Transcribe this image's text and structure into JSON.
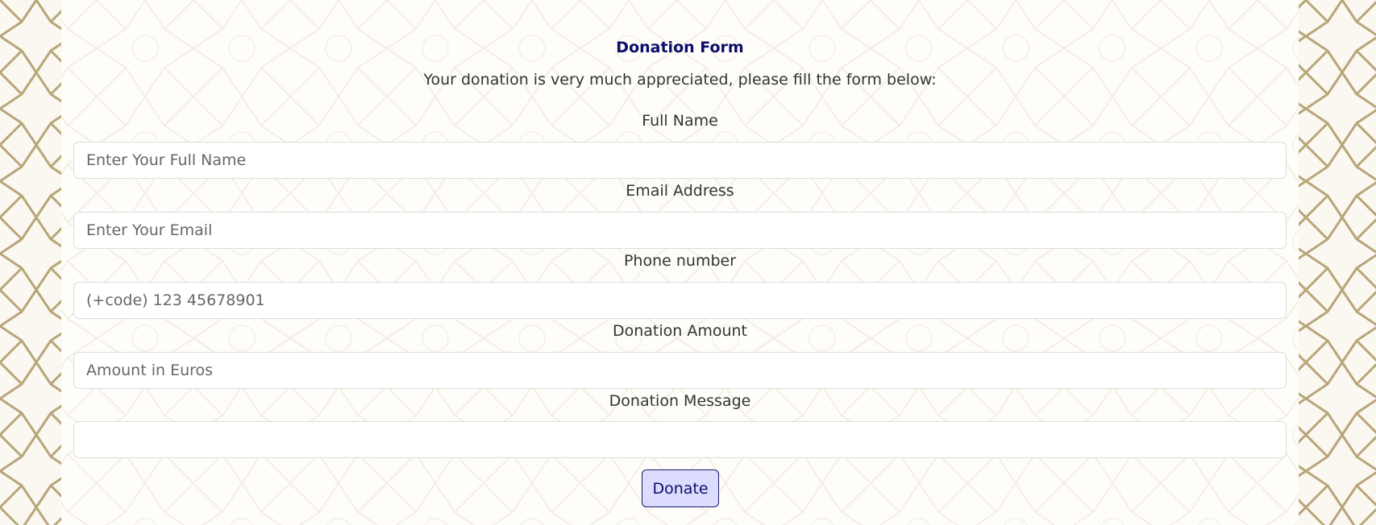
{
  "form": {
    "title": "Donation Form",
    "subtitle": "Your donation is very much appreciated, please fill the form below:",
    "full_name": {
      "label": "Full Name",
      "placeholder": "Enter Your Full Name"
    },
    "email": {
      "label": "Email Address",
      "placeholder": "Enter Your Email"
    },
    "phone": {
      "label": "Phone number",
      "placeholder": "(+code) 123 45678901"
    },
    "amount": {
      "label": "Donation Amount",
      "placeholder": "Amount in Euros"
    },
    "message": {
      "label": "Donation Message",
      "placeholder": ""
    },
    "submit_label": "Donate"
  },
  "colors": {
    "title": "#0d0d6b",
    "button_bg": "#dcdcff",
    "button_border": "#1a1a6b",
    "pattern_stroke": "#b8a57a",
    "pattern_faint": "#e9e2d0"
  },
  "decor": {
    "background_pattern": "geometric-star-lattice"
  }
}
